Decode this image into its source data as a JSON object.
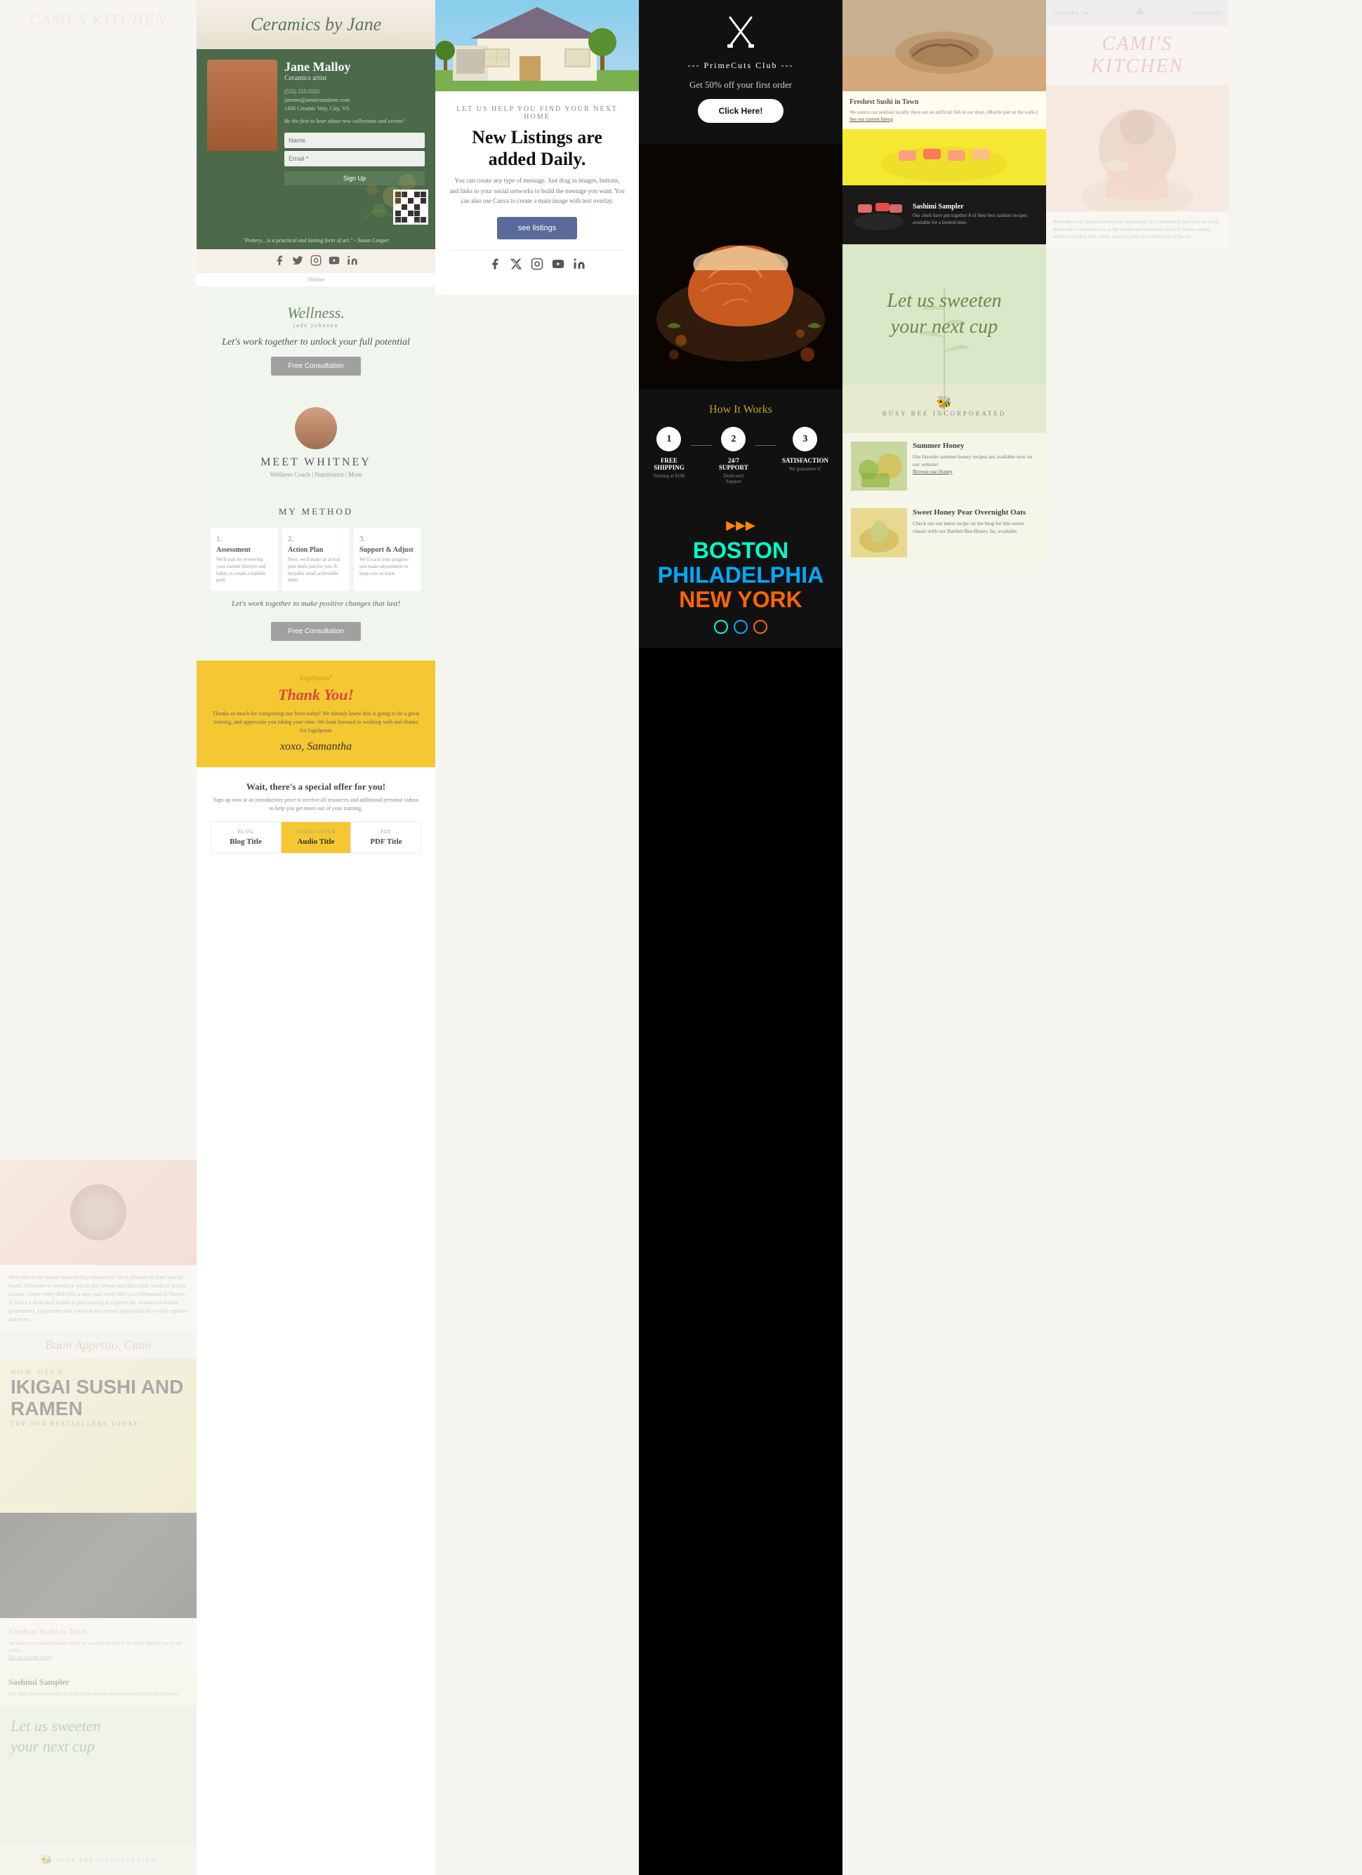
{
  "left_col": {
    "title": "CAMI'S KITCHEN",
    "now_open": "NOW OPEN",
    "sushi_name": "IKIGAI SUSHI AND RAMEN",
    "try_label": "TRY OUR BESTSELLERS TODAY!",
    "freshest_title": "Freshest Sushi in Town",
    "freshest_text": "We source our seafood locally, there are no artificial fish in our shop. (Maybe just on the walls.)",
    "see_lineup": "See our current lineup",
    "sashimi_title": "Sashimi Sampler",
    "sashimi_text": "Our chefs have put together 8 of their best sashimi recipes available for a limited time.",
    "sweeten_line1": "Let us sweeten",
    "sweeten_line2": "your next cup",
    "busybee_label": "BUSY BEE INCORPORATED"
  },
  "ceramics": {
    "title": "Ceramics by Jane",
    "name": "Jane Malloy",
    "subtitle": "Ceramics artist",
    "phone": "(555) 555-5555",
    "email": "janeme@sensivemalone.com",
    "address": "1456 Ceramic Way, City, VA",
    "signup_text": "Be the first to hear about new collections and events!",
    "name_placeholder": "Name",
    "email_placeholder": "Email *",
    "btn_label": "Sign Up",
    "quote": "\"Pottery... is a practical and lasting form of art.\" - Susan Cooper",
    "aweber_text": "AWeber",
    "social_icons": [
      "facebook",
      "twitter",
      "instagram",
      "youtube",
      "linkedin"
    ]
  },
  "wellness": {
    "logo": "Wellness.",
    "logo_sub": "jade johnson",
    "tagline": "Let's work together to unlock your full potential",
    "cta": "Free Consultation",
    "meet_label": "MEET WHITNEY",
    "meet_subtitle": "Wellness Coach | Nutritionist | Mom",
    "method_title": "MY METHOD",
    "method_1_num": "1.",
    "method_1_title": "Assessment",
    "method_1_text": "We'll start by reviewing your current lifestyle and habits to create a realistic goal.",
    "method_2_num": "2.",
    "method_2_title": "Action Plan",
    "method_2_text": "Next, we'll make an action plan that's just for you. It includes small achievable steps.",
    "method_3_num": "3.",
    "method_3_title": "Support & Adjust",
    "method_3_text": "We'll track your progress and make adjustments to keep you on track.",
    "cta_text": "Let's work together to make positive changes that last!",
    "cta2": "Free Consultation"
  },
  "thankyou": {
    "logo": "logolpsum°",
    "title": "Thank You!",
    "text": "Thanks so much for completing our form today! We already know this is going to be a great training, and appreciate you taking your time. We look forward to working with and thanks for logolpsum",
    "signature": "xoxo, Samantha",
    "special_offer_title": "Wait, there's a special offer for you!",
    "special_offer_text": "Sign up now at an introductory price to receive all resources and additional personal videos to help you get more out of your training.",
    "blog_label": "BLOG",
    "blog_title": "Blog Title",
    "audio_label": "AUDIO OFFER",
    "audio_title": "Audio Title",
    "pdf_label": "PDF",
    "pdf_title": "PDF Title"
  },
  "realestate": {
    "pre_title": "LET US HELP YOU FIND YOUR NEXT HOME",
    "title_line1": "New Listings are",
    "title_line2": "added Daily.",
    "desc": "You can create any type of message. Just drag in images, buttons, and links to your social networks to build the message you want. You can also use Canva to create a main image with text overlay.",
    "btn": "see listings",
    "social_icons": [
      "facebook",
      "twitter",
      "instagram",
      "youtube",
      "linkedin"
    ]
  },
  "primecuts": {
    "icon": "🔪🔪",
    "dashes": "--- PrimeCuts Club ---",
    "offer": "Get 50% off your first order",
    "cta": "Click Here!",
    "how_title": "How It Works",
    "step1_num": "1",
    "step1_title": "FREE SHIPPING",
    "step1_sub": "Starting at $100",
    "step2_num": "2",
    "step2_title": "24/7 SUPPORT",
    "step2_sub": "Dedicated Support",
    "step3_num": "3",
    "step3_title": "SATISFACTION",
    "step3_sub": "We guarantee it!",
    "city1": "BOSTON",
    "city2": "PHILADELPHIA",
    "city3": "NEW YORK"
  },
  "honey": {
    "seafood_title": "Freshest Sushi in Town",
    "seafood_text": "We source our seafood locally, there are no artificial fish in our shop. (Maybe just on the walls.)",
    "seafood_link": "See our current lineup",
    "sashimi_title": "Sashimi Sampler",
    "sashimi_text": "Our chefs have put together 8 of their best sashimi recipes available for a limited time.",
    "sweeten_line1": "Let us sweeten",
    "sweeten_line2": "your next cup",
    "busybee_logo": "🐝",
    "busybee_label": "BUSY BEE INCORPORATED",
    "summer_title": "Summer Honey",
    "summer_text": "Our favorite summer honey recipes are available now on our website!",
    "summer_link": "Browse our Honey",
    "pear_title": "Sweet Honey Pear Overnight Oats",
    "pear_text": "Check out our latest recipe on the blog for this sweet classic with our Bartlett Bee-Honey Jar, available"
  },
  "right_col": {
    "date": "JANUARY '24",
    "welcome": "WELCOME!",
    "title": "CAMI'S KITCHEN",
    "intro": "Welcome to my Italian food-loving community! It's a pleasure to have you on board. Allow me to introduce you to the vibrant and delectable world of Italian cuisine, where every dish tells a story and every bite is a celebration of flavors."
  }
}
